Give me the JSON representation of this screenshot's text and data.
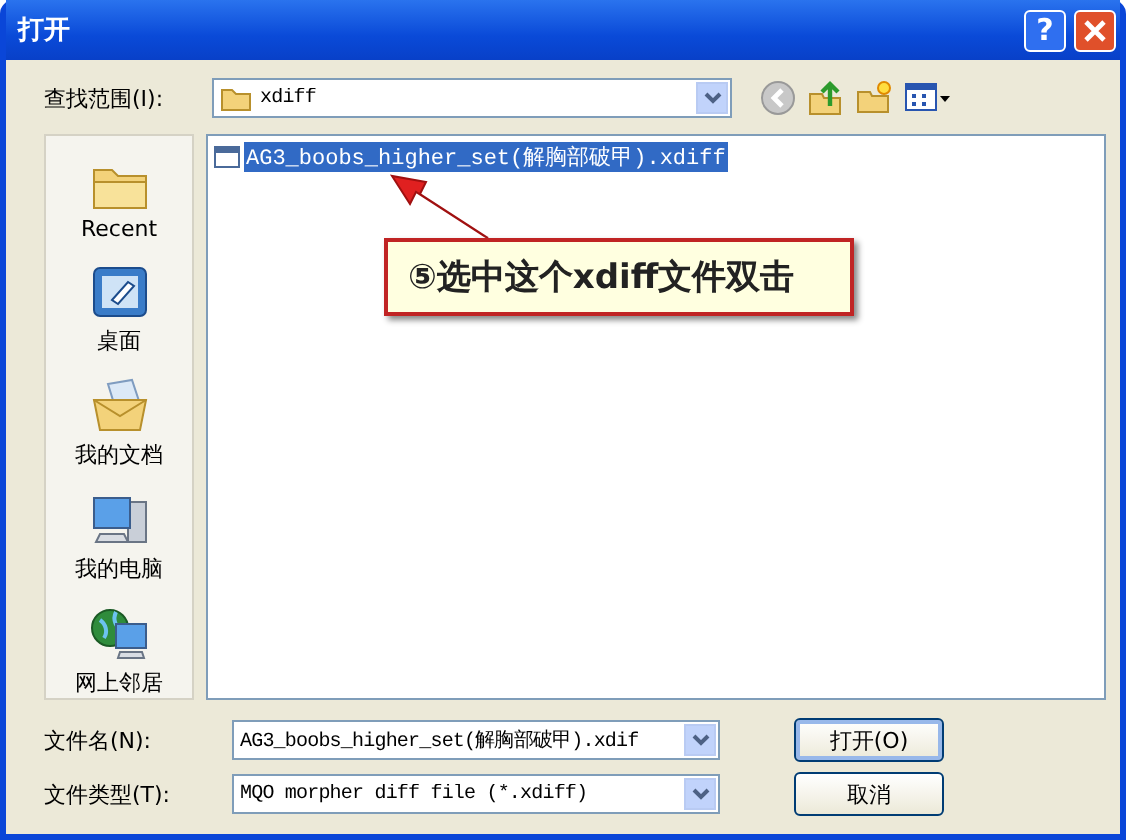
{
  "window": {
    "title": "打开",
    "help_button": "?"
  },
  "look_in": {
    "label": "查找范围(I):",
    "value": "xdiff"
  },
  "places": [
    {
      "label": "Recent",
      "kind": "recent"
    },
    {
      "label": "桌面",
      "kind": "desktop"
    },
    {
      "label": "我的文档",
      "kind": "documents"
    },
    {
      "label": "我的电脑",
      "kind": "computer"
    },
    {
      "label": "网上邻居",
      "kind": "network"
    }
  ],
  "files": [
    {
      "name": "AG3_boobs_higher_set(解胸部破甲).xdiff",
      "selected": true
    }
  ],
  "callout": {
    "text": "⑤选中这个xdiff文件双击"
  },
  "file_name": {
    "label": "文件名(N):",
    "value": "AG3_boobs_higher_set(解胸部破甲).xdif"
  },
  "file_type": {
    "label": "文件类型(T):",
    "value": "MQO morpher diff file (*.xdiff)"
  },
  "buttons": [
    {
      "label": "打开(O)",
      "default": true
    },
    {
      "label": "取消",
      "default": false
    }
  ]
}
